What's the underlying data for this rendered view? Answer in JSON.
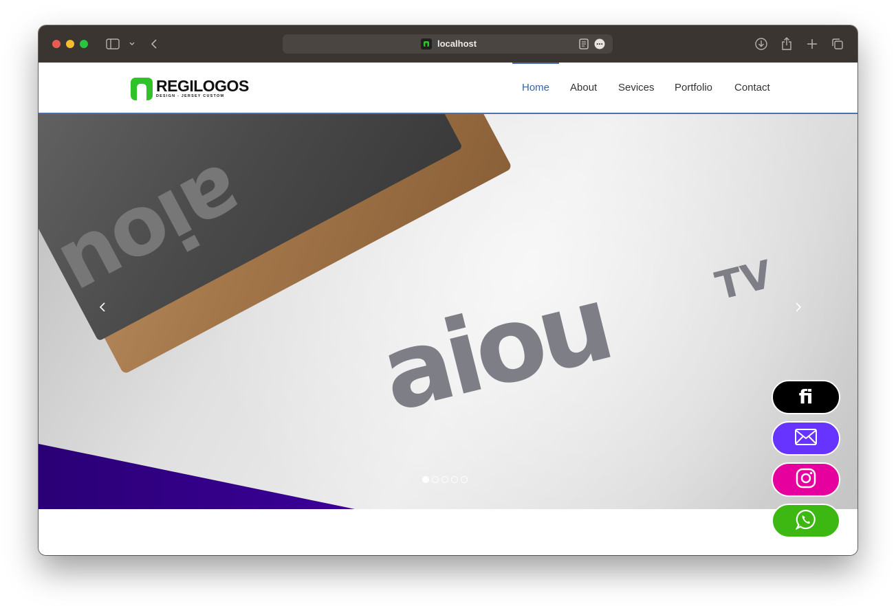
{
  "browser": {
    "url": "localhost",
    "colors": {
      "close": "#ee5a52",
      "minimize": "#f5bd2f",
      "zoom": "#29c440"
    }
  },
  "site": {
    "brand": {
      "name": "REGILOGOS",
      "tagline": "DESIGN - JERSEY CUSTOM",
      "color": "#2fc22a"
    },
    "nav": [
      {
        "label": "Home",
        "active": true
      },
      {
        "label": "About",
        "active": false
      },
      {
        "label": "Sevices",
        "active": false
      },
      {
        "label": "Portfolio",
        "active": false
      },
      {
        "label": "Contact",
        "active": false
      }
    ]
  },
  "hero": {
    "stamp_text": "aiou",
    "imprint_text": "aiou",
    "imprint_super": "TV",
    "prev_icon": "chevron-left-icon",
    "next_icon": "chevron-right-icon",
    "slides_total": 5,
    "slide_active": 1
  },
  "floating": [
    {
      "icon": "fiverr-icon",
      "label": "fi",
      "color": "#000000"
    },
    {
      "icon": "mail-icon",
      "label": "",
      "color": "#6633ff"
    },
    {
      "icon": "instagram-icon",
      "label": "",
      "color": "#e6009e"
    },
    {
      "icon": "whatsapp-icon",
      "label": "",
      "color": "#3db812"
    }
  ]
}
